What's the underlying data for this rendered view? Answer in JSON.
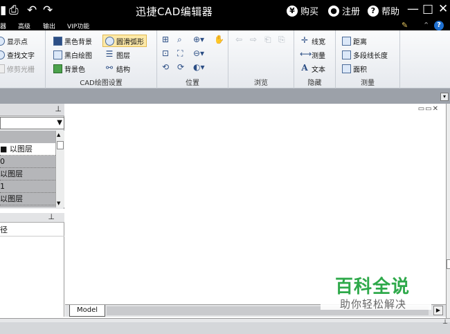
{
  "titlebar": {
    "title": "迅捷CAD编辑器",
    "buy_label": "购买",
    "register_label": "注册",
    "help_label": "帮助",
    "buy_icon_glyph": "¥",
    "help_icon_glyph": "?"
  },
  "menubar": {
    "items": [
      "器",
      "高级",
      "输出",
      "VIP功能"
    ],
    "help_glyph": "?"
  },
  "ribbon": {
    "group1": {
      "items": [
        "显示点",
        "查找文字",
        "修剪光栅"
      ]
    },
    "group2": {
      "label": "CAD绘图设置",
      "items": [
        "黑色背景",
        "黑白绘图",
        "背景色",
        "圆滑弧形",
        "图层",
        "结构"
      ]
    },
    "group3": {
      "label": "位置"
    },
    "group4": {
      "label": "浏览"
    },
    "group5": {
      "label": "隐藏",
      "items": [
        "线宽",
        "测量",
        "文本"
      ]
    },
    "group6": {
      "label": "测量",
      "items": [
        "距离",
        "多段线长度",
        "面积"
      ]
    }
  },
  "layers_panel": {
    "rows": [
      "■ 以图层",
      "0",
      "以图层",
      "1",
      "以图层"
    ]
  },
  "props_panel": {
    "row": "径"
  },
  "canvas": {
    "tab_label": "Model"
  },
  "watermark": {
    "title": "百科全说",
    "subtitle": "助你轻松解决"
  }
}
